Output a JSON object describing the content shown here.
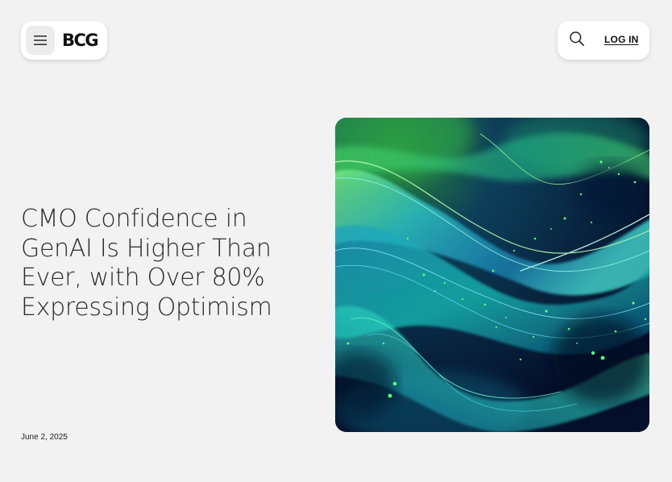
{
  "header": {
    "logo_text": "BCG",
    "login_label": "LOG IN",
    "menu_icon": "hamburger-icon",
    "search_icon": "search-icon"
  },
  "article": {
    "title": "CMO Confidence in GenAI Is Higher Than Ever, with Over 80% Expressing Optimism",
    "date": "June 2, 2025"
  },
  "colors": {
    "background": "#f2f2f2",
    "card": "#ffffff",
    "text": "#212121",
    "hero_dark": "#061836",
    "hero_teal": "#1fb3c8",
    "hero_green": "#3cf06e"
  }
}
